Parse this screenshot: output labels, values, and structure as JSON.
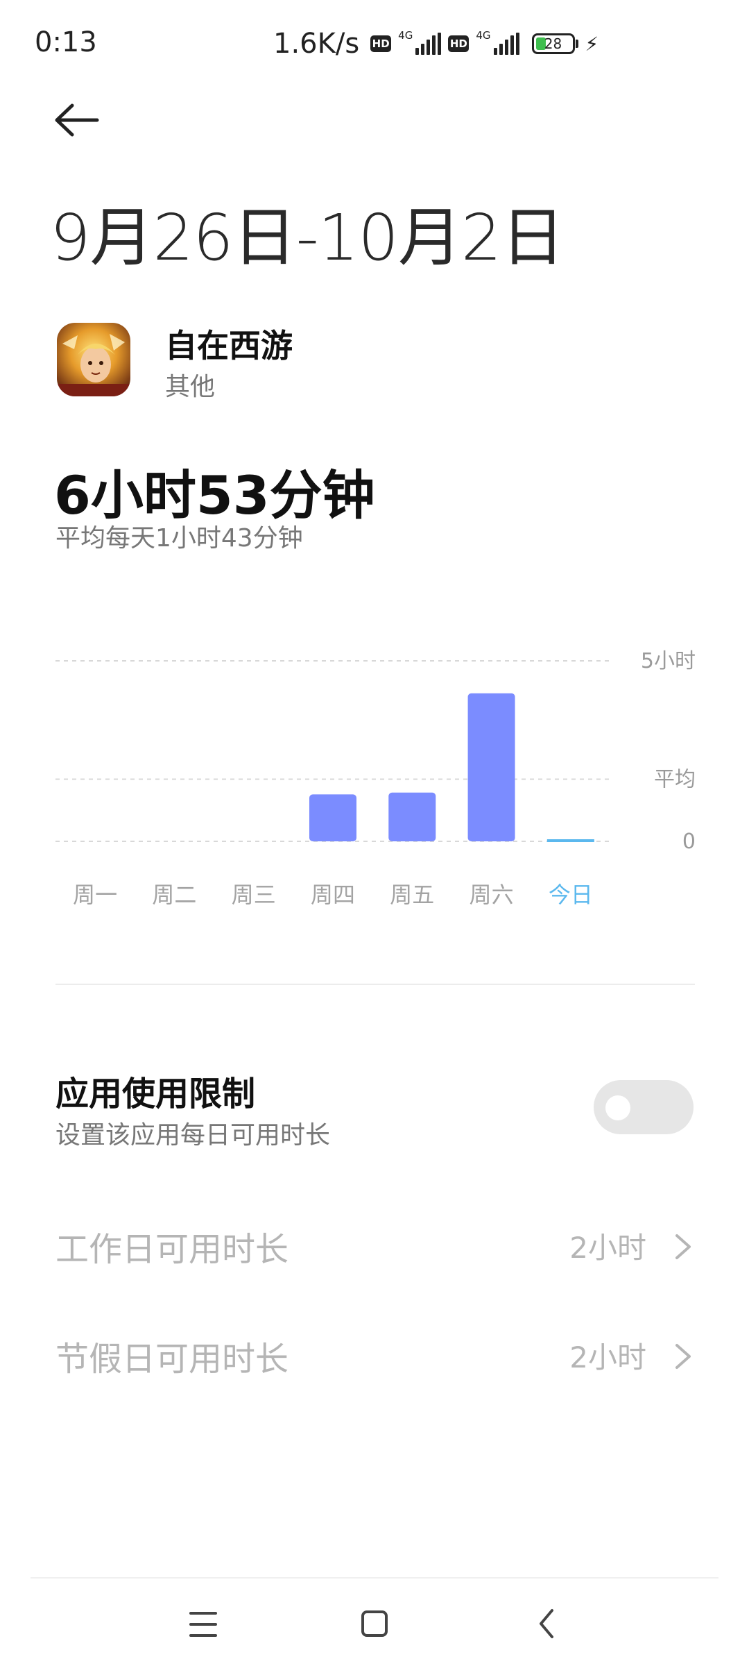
{
  "status_bar": {
    "time": "0:13",
    "net_speed": "1.6K/s",
    "hd_label": "HD",
    "network_type": "4G",
    "battery_level": "28",
    "charging": true
  },
  "header": {
    "date_range": "9月26日-10月2日"
  },
  "app": {
    "name": "自在西游",
    "category": "其他",
    "icon": "game-app-icon"
  },
  "usage": {
    "total": "6小时53分钟",
    "average": "平均每天1小时43分钟"
  },
  "chart_data": {
    "type": "bar",
    "categories": [
      "周一",
      "周二",
      "周三",
      "周四",
      "周五",
      "周六",
      "今日"
    ],
    "values": [
      0,
      0,
      0,
      1.3,
      1.35,
      4.1,
      0.03
    ],
    "y_tick_labels": [
      "5小时",
      "平均",
      "0"
    ],
    "ylim": [
      0,
      5
    ],
    "average_line": 1.72,
    "grid": true,
    "bar_color": "#7b8cff",
    "highlight_color": "#5bb8ee",
    "highlight_category": "今日"
  },
  "limit": {
    "title": "应用使用限制",
    "subtitle": "设置该应用每日可用时长",
    "enabled": false
  },
  "settings": [
    {
      "label": "工作日可用时长",
      "value": "2小时"
    },
    {
      "label": "节假日可用时长",
      "value": "2小时"
    }
  ],
  "nav": {
    "menu": "menu-icon",
    "home": "home-icon",
    "back": "back-icon"
  }
}
